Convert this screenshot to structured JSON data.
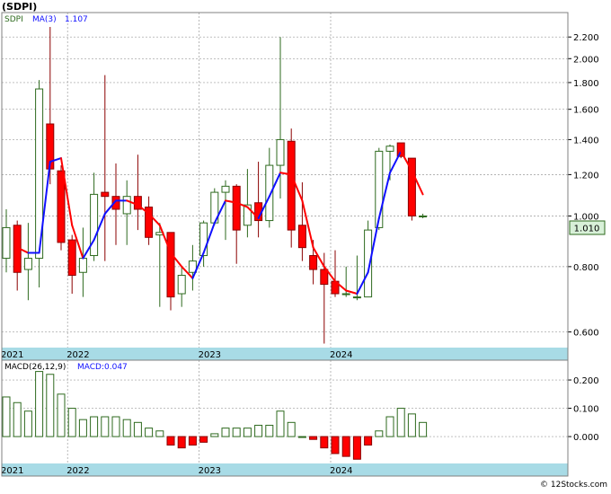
{
  "ticker_label": "(SDPI)",
  "watermark": "© 12Stocks.com",
  "last_price_badge": "1.010",
  "colors": {
    "up_fill": "#ffffff",
    "up_stroke": "#2e6a1e",
    "down_fill": "#ff0000",
    "down_stroke": "#8b0000",
    "ma_up": "#1010ff",
    "ma_down": "#ff0000",
    "macd_pos_fill": "#ffffff",
    "macd_pos_stroke": "#2e6a1e",
    "macd_neg_fill": "#ff0000",
    "axis_band": "#a8dbe6",
    "badge_fill": "#d8f0d8",
    "grid": "#9a9a9a"
  },
  "chart_data": [
    {
      "type": "candlestick",
      "legend": {
        "symbol": "SDPI",
        "ma_label": "MA(3)",
        "ma_value": "1.107"
      },
      "scale": "log",
      "ylim": [
        0.56,
        2.45
      ],
      "y_ticks": [
        "0.600",
        "0.800",
        "1.000",
        "1.200",
        "1.400",
        "1.600",
        "1.800",
        "2.000",
        "2.200"
      ],
      "x_tick_labels": [
        {
          "label": "2021",
          "index": 0
        },
        {
          "label": "2022",
          "index": 6
        },
        {
          "label": "2023",
          "index": 18
        },
        {
          "label": "2024",
          "index": 30
        }
      ],
      "ohlc": [
        [
          0.83,
          1.03,
          0.78,
          0.95
        ],
        [
          0.96,
          0.98,
          0.72,
          0.78
        ],
        [
          0.79,
          0.97,
          0.69,
          0.83
        ],
        [
          0.83,
          1.82,
          0.73,
          1.75
        ],
        [
          1.5,
          2.3,
          1.15,
          1.23
        ],
        [
          1.22,
          1.25,
          0.86,
          0.89
        ],
        [
          0.9,
          0.92,
          0.71,
          0.77
        ],
        [
          0.78,
          0.95,
          0.7,
          0.83
        ],
        [
          0.84,
          1.21,
          0.82,
          1.1
        ],
        [
          1.11,
          1.86,
          0.82,
          1.09
        ],
        [
          1.09,
          1.26,
          0.88,
          1.03
        ],
        [
          1.01,
          1.17,
          0.88,
          1.09
        ],
        [
          1.09,
          1.31,
          0.94,
          1.03
        ],
        [
          1.04,
          1.09,
          0.88,
          0.91
        ],
        [
          0.92,
          0.97,
          0.67,
          0.93
        ],
        [
          0.93,
          0.93,
          0.66,
          0.7
        ],
        [
          0.71,
          0.8,
          0.67,
          0.77
        ],
        [
          0.78,
          0.88,
          0.72,
          0.82
        ],
        [
          0.84,
          0.98,
          0.8,
          0.97
        ],
        [
          0.97,
          1.13,
          0.96,
          1.11
        ],
        [
          1.11,
          1.17,
          0.9,
          1.14
        ],
        [
          1.14,
          1.15,
          0.81,
          0.94
        ],
        [
          0.96,
          1.23,
          0.91,
          1.05
        ],
        [
          1.06,
          1.27,
          0.91,
          0.98
        ],
        [
          0.98,
          1.35,
          0.95,
          1.25
        ],
        [
          1.25,
          2.2,
          1.08,
          1.4
        ],
        [
          1.39,
          1.47,
          0.87,
          0.94
        ],
        [
          0.96,
          1.16,
          0.82,
          0.87
        ],
        [
          0.84,
          0.9,
          0.74,
          0.79
        ],
        [
          0.79,
          0.85,
          0.57,
          0.74
        ],
        [
          0.75,
          0.86,
          0.7,
          0.71
        ],
        [
          0.71,
          0.8,
          0.7,
          0.71
        ],
        [
          0.7,
          0.84,
          0.69,
          0.7
        ],
        [
          0.7,
          0.98,
          0.7,
          0.94
        ],
        [
          0.95,
          1.35,
          0.94,
          1.33
        ],
        [
          1.33,
          1.37,
          1.17,
          1.36
        ],
        [
          1.38,
          1.38,
          1.29,
          1.3
        ],
        [
          1.29,
          1.29,
          0.98,
          1.0
        ],
        [
          1.0,
          1.01,
          0.99,
          1.0
        ]
      ],
      "ma3": [
        null,
        0.87,
        0.85,
        0.85,
        1.27,
        1.29,
        0.96,
        0.83,
        0.9,
        1.01,
        1.07,
        1.07,
        1.05,
        1.01,
        0.96,
        0.85,
        0.8,
        0.76,
        0.85,
        0.97,
        1.07,
        1.06,
        1.04,
        0.99,
        1.09,
        1.21,
        1.2,
        1.07,
        0.87,
        0.8,
        0.75,
        0.72,
        0.71,
        0.78,
        0.99,
        1.21,
        1.33,
        1.22,
        1.1
      ]
    },
    {
      "type": "bar",
      "legend": {
        "label": "MACD(26,12,9)",
        "value_label": "MACD:0.047"
      },
      "ylim": [
        -0.095,
        0.27
      ],
      "y_ticks": [
        "0.200",
        "0.100",
        "0.000"
      ],
      "x_tick_labels": [
        {
          "label": "2021",
          "index": 0
        },
        {
          "label": "2022",
          "index": 6
        },
        {
          "label": "2023",
          "index": 18
        },
        {
          "label": "2024",
          "index": 30
        }
      ],
      "values": [
        0.14,
        0.12,
        0.09,
        0.23,
        0.22,
        0.15,
        0.1,
        0.06,
        0.07,
        0.07,
        0.07,
        0.06,
        0.05,
        0.03,
        0.02,
        -0.03,
        -0.04,
        -0.03,
        -0.02,
        0.01,
        0.03,
        0.03,
        0.03,
        0.04,
        0.04,
        0.09,
        0.05,
        0.0,
        -0.01,
        -0.04,
        -0.06,
        -0.07,
        -0.08,
        -0.03,
        0.02,
        0.07,
        0.1,
        0.08,
        0.05
      ]
    }
  ]
}
